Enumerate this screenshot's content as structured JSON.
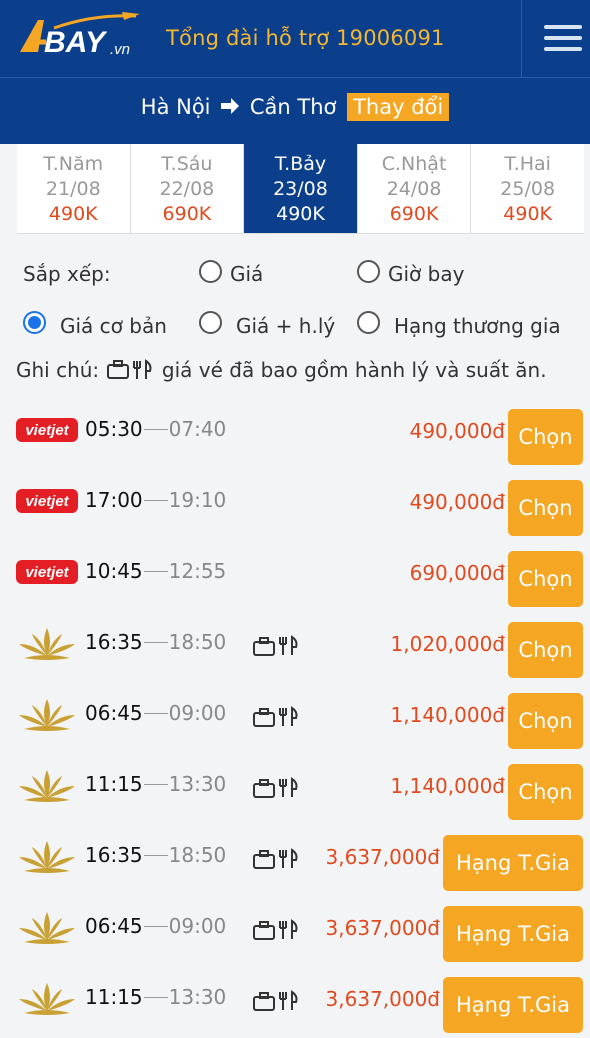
{
  "header": {
    "logo_text": "BAY",
    "logo_suffix": ".vn",
    "hotline": "Tổng đài hỗ trợ 19006091"
  },
  "route": {
    "from": "Hà Nội",
    "to": "Cần Thơ",
    "change_label": "Thay đổi"
  },
  "dates": [
    {
      "day": "T.Năm",
      "date": "21/08",
      "price": "490K"
    },
    {
      "day": "T.Sáu",
      "date": "22/08",
      "price": "690K"
    },
    {
      "day": "T.Bảy",
      "date": "23/08",
      "price": "490K"
    },
    {
      "day": "C.Nhật",
      "date": "24/08",
      "price": "690K"
    },
    {
      "day": "T.Hai",
      "date": "25/08",
      "price": "490K"
    }
  ],
  "sort": {
    "label": "Sắp xếp:",
    "opt_price": "Giá",
    "opt_time": "Giờ bay",
    "opt_base": "Giá cơ bản",
    "opt_luggage": "Giá + h.lý",
    "opt_business": "Hạng thương gia"
  },
  "note": {
    "prefix": "Ghi chú:",
    "text": "giá vé đã bao gồm hành lý và suất ăn."
  },
  "flights": [
    {
      "airline": "vietjet",
      "dep": "05:30",
      "arr": "07:40",
      "price": "490,000đ",
      "button": "Chọn"
    },
    {
      "airline": "vietjet",
      "dep": "17:00",
      "arr": "19:10",
      "price": "490,000đ",
      "button": "Chọn"
    },
    {
      "airline": "vietjet",
      "dep": "10:45",
      "arr": "12:55",
      "price": "690,000đ",
      "button": "Chọn"
    },
    {
      "airline": "vietnam-airlines",
      "dep": "16:35",
      "arr": "18:50",
      "price": "1,020,000đ",
      "button": "Chọn"
    },
    {
      "airline": "vietnam-airlines",
      "dep": "06:45",
      "arr": "09:00",
      "price": "1,140,000đ",
      "button": "Chọn"
    },
    {
      "airline": "vietnam-airlines",
      "dep": "11:15",
      "arr": "13:30",
      "price": "1,140,000đ",
      "button": "Chọn"
    },
    {
      "airline": "vietnam-airlines",
      "dep": "16:35",
      "arr": "18:50",
      "price": "3,637,000đ",
      "button": "Hạng T.Gia"
    },
    {
      "airline": "vietnam-airlines",
      "dep": "06:45",
      "arr": "09:00",
      "price": "3,637,000đ",
      "button": "Hạng T.Gia"
    },
    {
      "airline": "vietnam-airlines",
      "dep": "11:15",
      "arr": "13:30",
      "price": "3,637,000đ",
      "button": "Hạng T.Gia"
    }
  ],
  "vietjet_logo_text": "vietjet",
  "colors": {
    "header": "#0b3f8c",
    "accent": "#f5a623",
    "price": "#e04a1f",
    "radio": "#1a73e8"
  },
  "icons": [
    "plane-icon",
    "arrow-right-icon",
    "menu-icon",
    "luggage-icon",
    "meal-icon",
    "lotus-logo-icon"
  ]
}
